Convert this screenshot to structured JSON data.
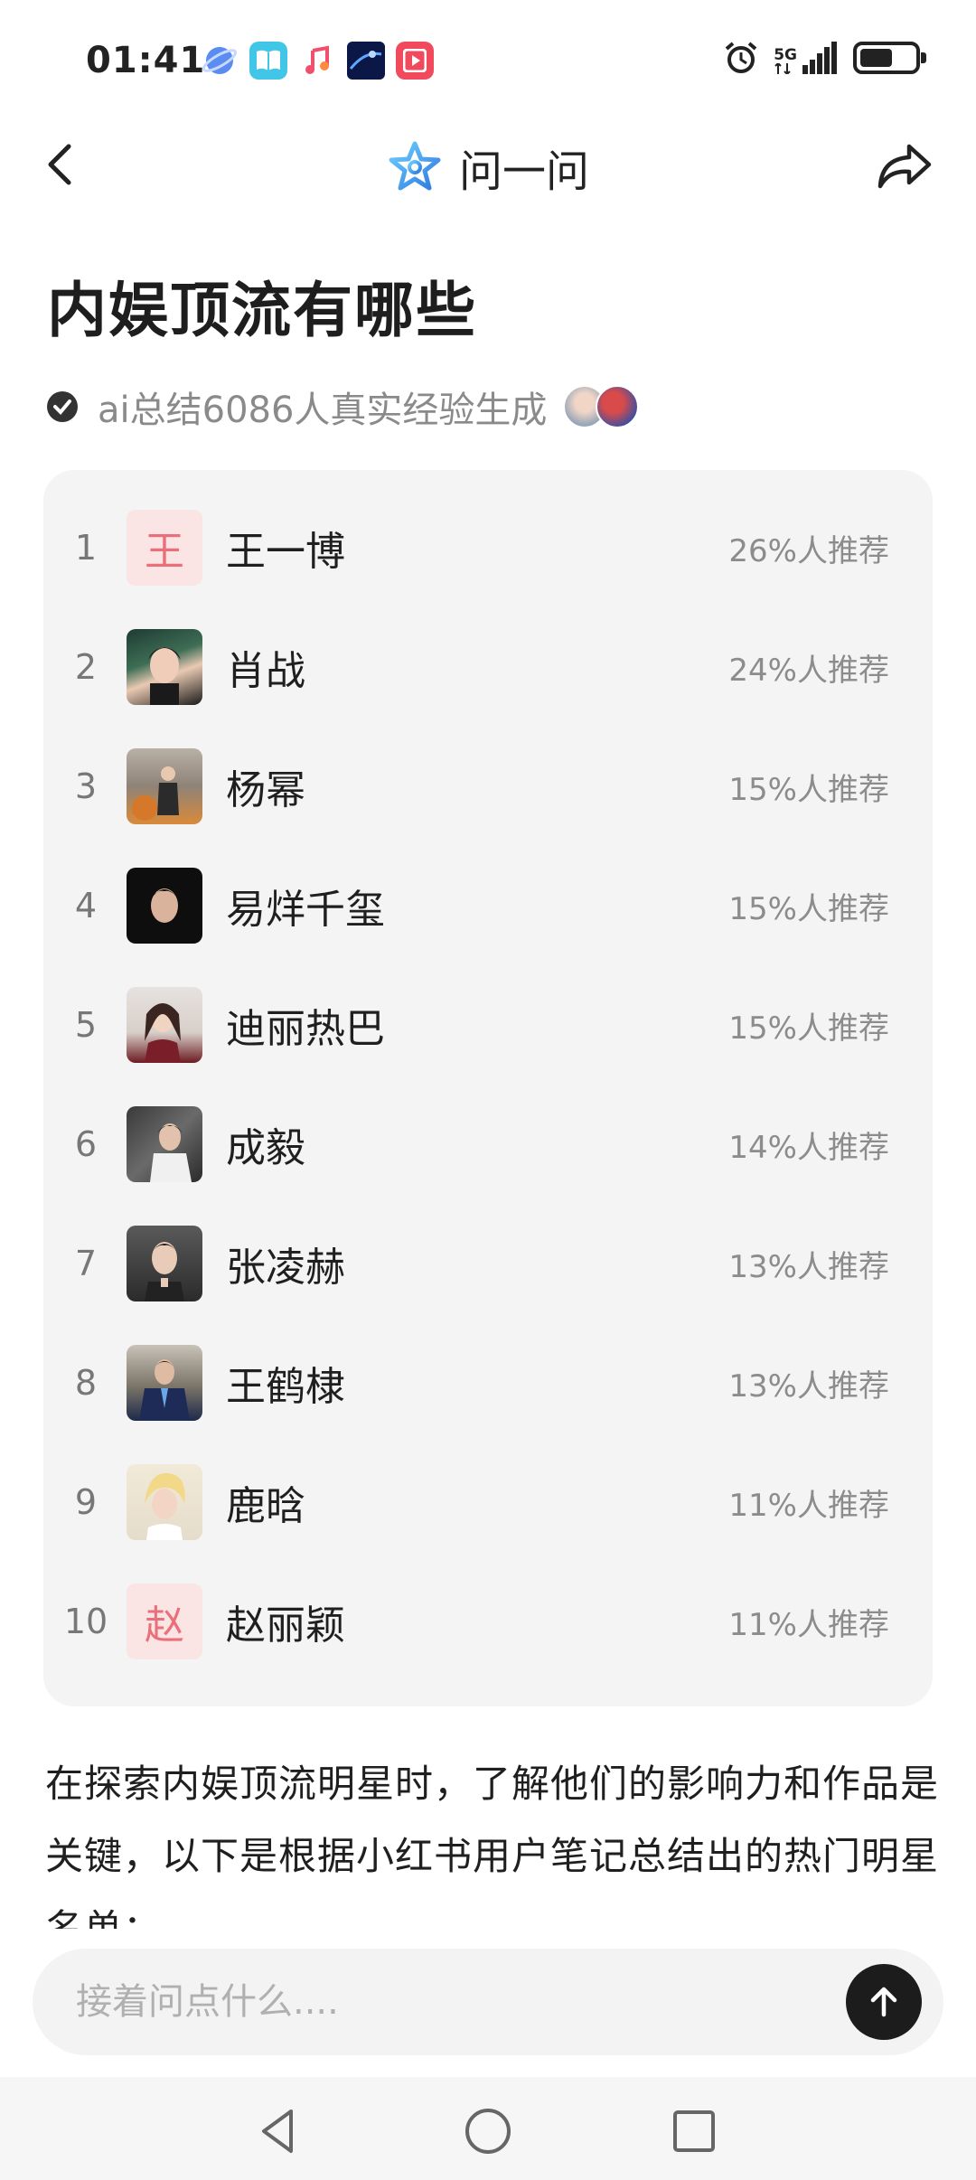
{
  "status_bar": {
    "time": "01:41",
    "network": "5G",
    "apps": [
      "browser-icon",
      "book-icon",
      "music-icon",
      "media-icon",
      "video-icon"
    ]
  },
  "nav": {
    "title": "问一问"
  },
  "page": {
    "title": "内娱顶流有哪些",
    "subtitle": "ai总结6086人真实经验生成"
  },
  "ranking": [
    {
      "rank": "1",
      "name": "王一博",
      "percent": "26%人推荐",
      "avatar_letter": "王"
    },
    {
      "rank": "2",
      "name": "肖战",
      "percent": "24%人推荐",
      "avatar_letter": ""
    },
    {
      "rank": "3",
      "name": "杨幂",
      "percent": "15%人推荐",
      "avatar_letter": ""
    },
    {
      "rank": "4",
      "name": "易烊千玺",
      "percent": "15%人推荐",
      "avatar_letter": ""
    },
    {
      "rank": "5",
      "name": "迪丽热巴",
      "percent": "15%人推荐",
      "avatar_letter": ""
    },
    {
      "rank": "6",
      "name": "成毅",
      "percent": "14%人推荐",
      "avatar_letter": ""
    },
    {
      "rank": "7",
      "name": "张凌赫",
      "percent": "13%人推荐",
      "avatar_letter": ""
    },
    {
      "rank": "8",
      "name": "王鹤棣",
      "percent": "13%人推荐",
      "avatar_letter": ""
    },
    {
      "rank": "9",
      "name": "鹿晗",
      "percent": "11%人推荐",
      "avatar_letter": ""
    },
    {
      "rank": "10",
      "name": "赵丽颖",
      "percent": "11%人推荐",
      "avatar_letter": "赵"
    }
  ],
  "body": {
    "text": "在探索内娱顶流明星时，了解他们的影响力和作品是关键，以下是根据小红书用户笔记总结出的热门明星名单："
  },
  "ask": {
    "placeholder": "接着问点什么...."
  },
  "colors": {
    "card_bg": "#f4f4f4",
    "letter_avatar_bg": "#fbe4e4",
    "letter_avatar_fg": "#e9707a",
    "accent_icon": "#3aa0e6"
  }
}
